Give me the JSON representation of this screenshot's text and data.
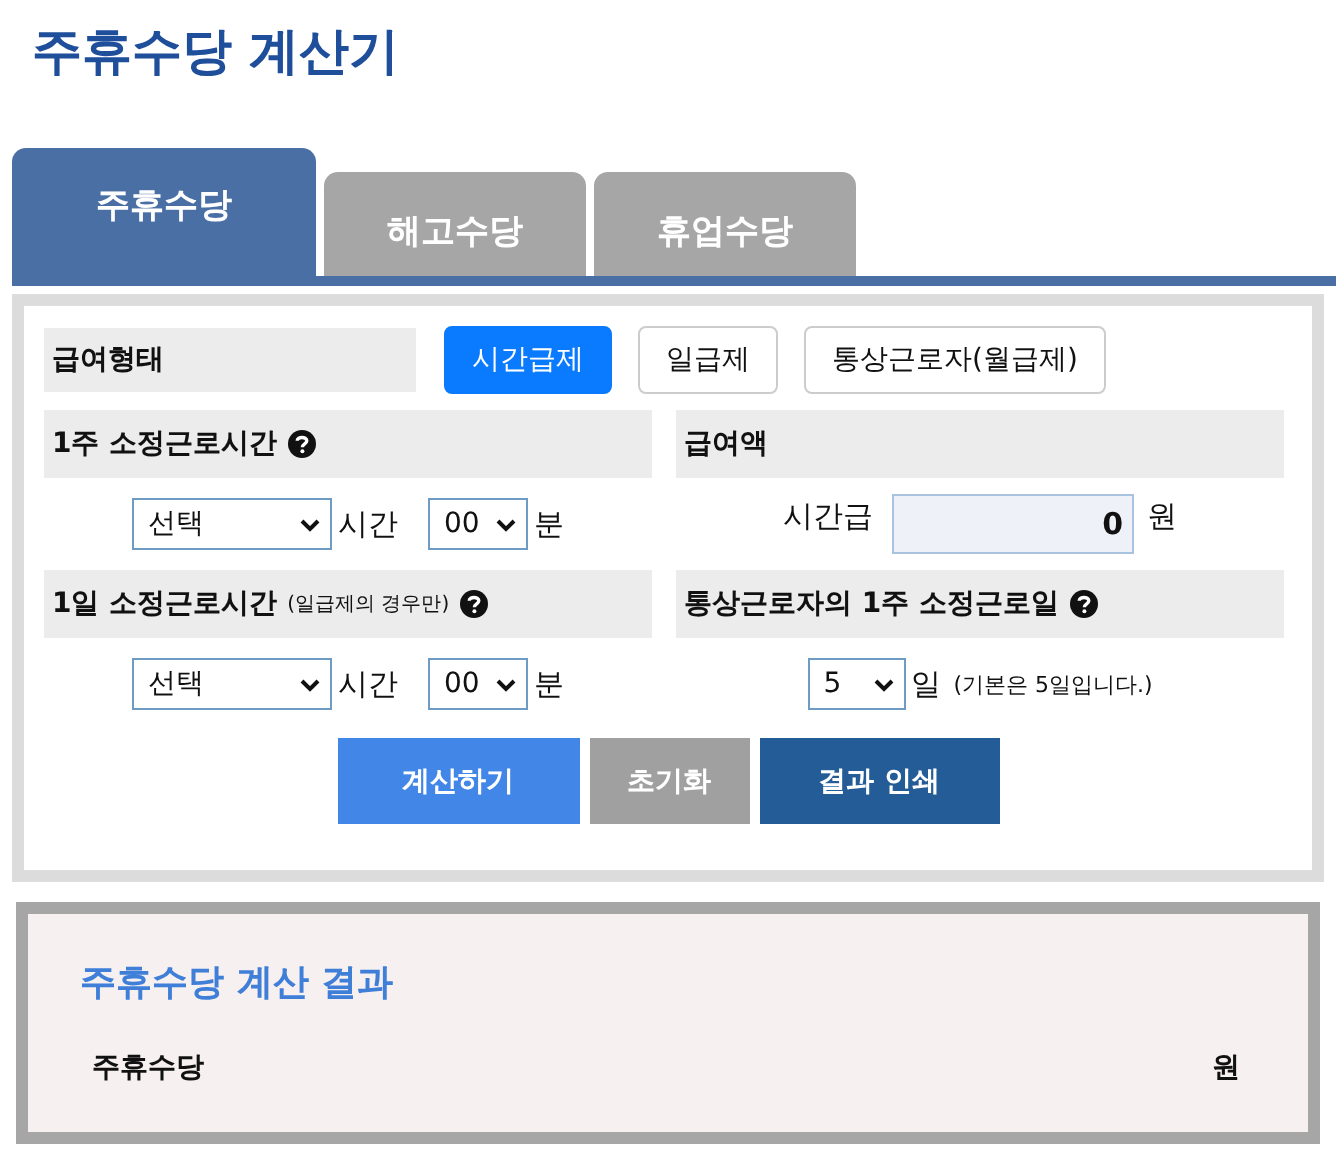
{
  "title": "주휴수당 계산기",
  "tabs": [
    {
      "label": "주휴수당",
      "selected": true
    },
    {
      "label": "해고수당",
      "selected": false
    },
    {
      "label": "휴업수당",
      "selected": false
    }
  ],
  "wage_type": {
    "label": "급여형태",
    "options": [
      {
        "label": "시간급제",
        "selected": true
      },
      {
        "label": "일급제",
        "selected": false
      },
      {
        "label": "통상근로자(월급제)",
        "selected": false
      }
    ]
  },
  "weekly_hours": {
    "label": "1주 소정근로시간",
    "help": true,
    "hours": "선택",
    "hours_unit": "시간",
    "minutes": "00",
    "minutes_unit": "분"
  },
  "wage_amount": {
    "label": "급여액",
    "help": false,
    "field_label": "시간급",
    "value": "0",
    "unit": "원"
  },
  "daily_hours": {
    "label": "1일 소정근로시간",
    "label_note": "(일급제의 경우만)",
    "help": true,
    "hours": "선택",
    "hours_unit": "시간",
    "minutes": "00",
    "minutes_unit": "분"
  },
  "work_days": {
    "label": "통상근로자의 1주 소정근로일",
    "help": true,
    "value": "5",
    "unit": "일",
    "note": "(기본은 5일입니다.)"
  },
  "buttons": [
    {
      "label": "계산하기",
      "kind": "primary"
    },
    {
      "label": "초기화",
      "kind": "secondary"
    },
    {
      "label": "결과 인쇄",
      "kind": "dark"
    }
  ],
  "result": {
    "title": "주휴수당 계산 결과",
    "rows": [
      {
        "label": "주휴수당",
        "unit": "원"
      }
    ]
  }
}
